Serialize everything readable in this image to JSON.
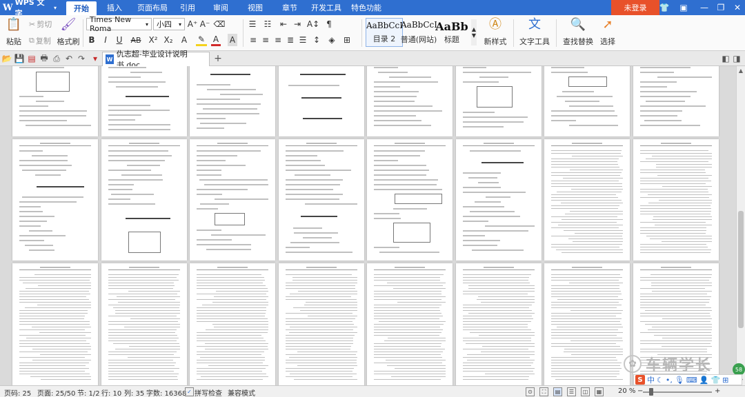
{
  "app": {
    "name": "WPS 文字"
  },
  "menu": {
    "tabs": [
      "开始",
      "插入",
      "页面布局",
      "引用",
      "审阅",
      "视图",
      "章节",
      "开发工具",
      "特色功能"
    ],
    "active": "开始",
    "login_label": "未登录"
  },
  "ribbon": {
    "paste": "粘贴",
    "cut": "剪切",
    "copy": "复制",
    "format_painter": "格式刷",
    "font_name": "Times New Roma",
    "font_size": "小四",
    "styles": [
      {
        "sample": "AaBbCcDd",
        "label": "目录 2"
      },
      {
        "sample": "AaBbCcDd",
        "label": "普通(网站)"
      },
      {
        "sample": "AaBb",
        "label": "标题"
      }
    ],
    "new_style": "新样式",
    "text_tools": "文字工具",
    "find_replace": "查找替换",
    "select": "选择"
  },
  "tabbar": {
    "document_title": "仇志超-毕业设计说明书.doc"
  },
  "statusbar": {
    "page_code": "页码: 25",
    "page": "页面: 25/50",
    "section": "节: 1/2",
    "row": "行: 10",
    "column": "列: 35",
    "word_count": "字数: 16368",
    "spell_check": "拼写检查",
    "mode": "兼容模式",
    "zoom": "20 %"
  },
  "watermark": {
    "text": "车辆学长"
  },
  "ime": {
    "mode": "中"
  },
  "badge": {
    "text": "58"
  },
  "colors": {
    "title_bar": "#2f6fd0",
    "login_button": "#e8512a",
    "workspace": "#dadada"
  },
  "icons": [
    "paste-icon",
    "cut-icon",
    "copy-icon",
    "format-painter-icon",
    "bold-icon",
    "italic-icon",
    "underline-icon",
    "find-replace-icon",
    "select-arrow-icon",
    "new-style-icon",
    "text-tools-icon"
  ]
}
